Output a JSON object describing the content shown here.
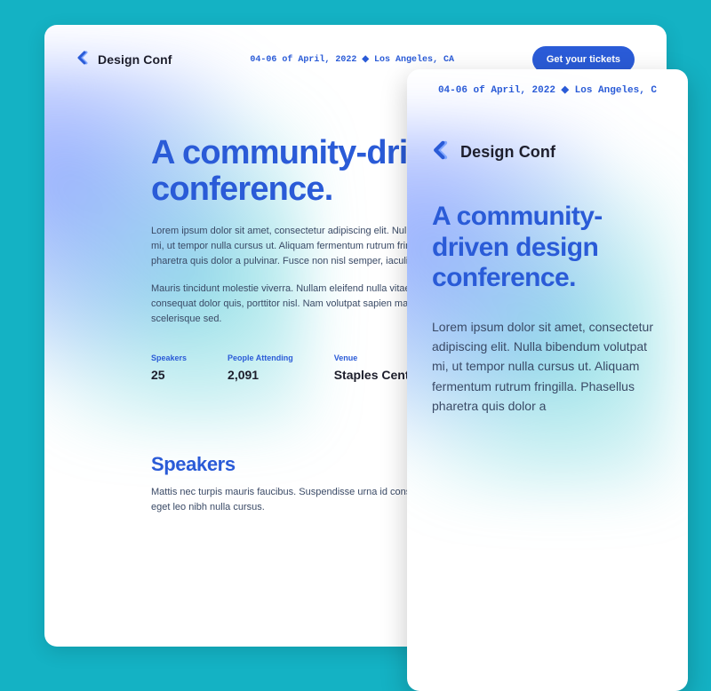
{
  "brand": {
    "name": "Design Conf"
  },
  "event": {
    "meta_desktop": "04-06 of April, 2022  ◆  Los Angeles, CA",
    "meta_mobile": "04-06 of April, 2022  ◆  Los Angeles, C"
  },
  "cta": {
    "label": "Get your tickets"
  },
  "hero": {
    "title_desktop": "A community-driven design conference.",
    "title_mobile": "A community-driven design conference.",
    "p1": "Lorem ipsum dolor sit amet, consectetur adipiscing elit. Nulla bibendum volutpat mi, ut tempor nulla cursus ut. Aliquam fermentum rutrum fringilla. Phasellus pharetra quis dolor a pulvinar. Fusce non nisl semper, iaculis tellus.",
    "p2": "Mauris tincidunt molestie viverra. Nullam eleifend nulla vitae nibh viverra a consequat dolor quis, porttitor nisl. Nam volutpat sapien magna, sagittis sapien scelerisque sed.",
    "p_mobile": "Lorem ipsum dolor sit amet, consectetur adipiscing elit. Nulla bibendum volutpat mi, ut tempor nulla cursus ut. Aliquam fermentum rutrum fringilla. Phasellus pharetra quis dolor a"
  },
  "stats": {
    "items": [
      {
        "label": "Speakers",
        "value": "25"
      },
      {
        "label": "People Attending",
        "value": "2,091"
      },
      {
        "label": "Venue",
        "value": "Staples Centre"
      }
    ]
  },
  "section_speakers": {
    "title": "Speakers",
    "copy": "Mattis nec turpis mauris faucibus. Suspendisse urna id consequat eget leo nibh nulla cursus."
  }
}
